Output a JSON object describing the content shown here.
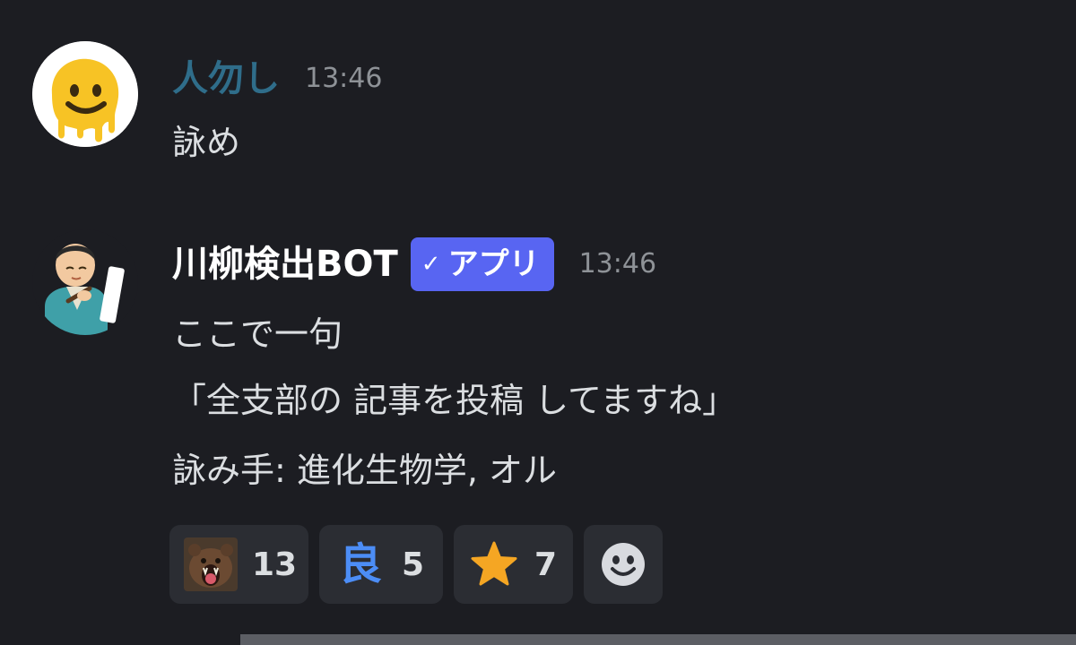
{
  "messages": [
    {
      "author": "人勿し",
      "author_color": "#2f6d8a",
      "time": "13:46",
      "lines": [
        "詠め"
      ],
      "avatar_icon": "melting-face-icon"
    },
    {
      "author": "川柳検出BOT",
      "author_color": "#ffffff",
      "badge": {
        "check": "✓",
        "label": "アプリ",
        "color": "#5865f2"
      },
      "time": "13:46",
      "lines": [
        "ここで一句",
        "「全支部の 記事を投稿 してますね」",
        "詠み手: 進化生物学, オル"
      ],
      "avatar_icon": "haiku-poet-icon"
    }
  ],
  "reactions": [
    {
      "emoji": "roaring-bear-icon",
      "count": "13"
    },
    {
      "emoji": "良",
      "emoji_color": "#4c8df6",
      "count": "5"
    },
    {
      "emoji": "star-icon",
      "emoji_color": "#f5a623",
      "count": "7"
    }
  ],
  "add_reaction_icon": "add-reaction-smiley-icon"
}
